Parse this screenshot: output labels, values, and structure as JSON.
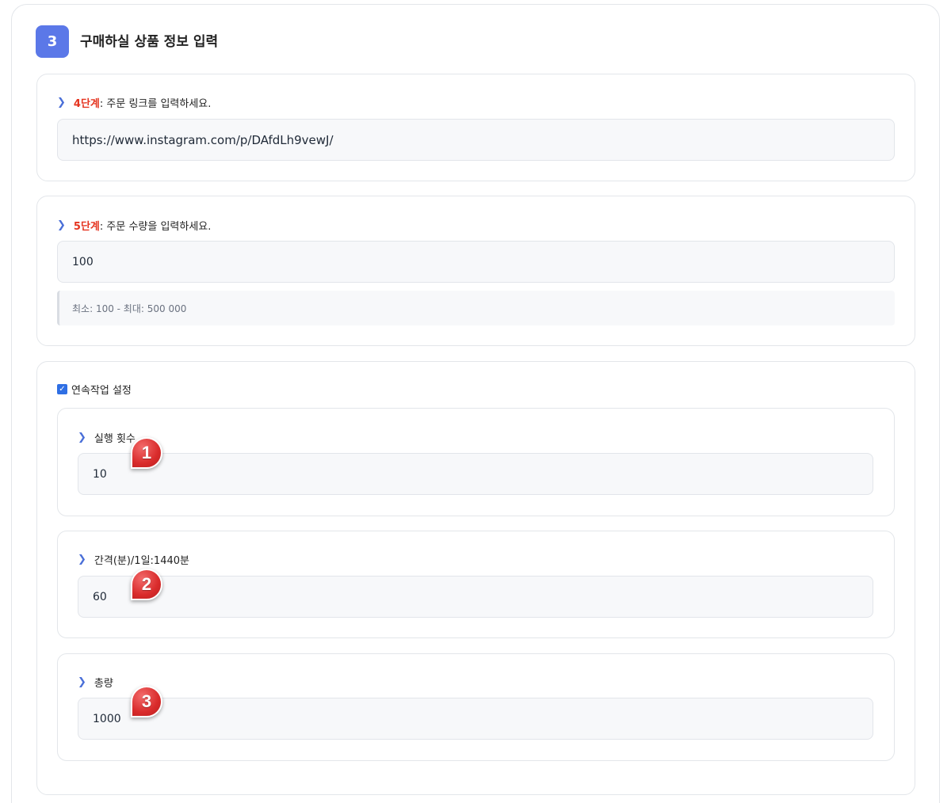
{
  "section": {
    "step_number": "3",
    "title": "구매하실 상품 정보 입력"
  },
  "link_step": {
    "step": "4단계",
    "label": ": 주문 링크를 입력하세요.",
    "value": "https://www.instagram.com/p/DAfdLh9vewJ/"
  },
  "quantity_step": {
    "step": "5단계",
    "label": ": 주문 수량을 입력하세요.",
    "value": "100",
    "hint": "최소: 100 - 최대: 500 000"
  },
  "repeat": {
    "checkbox_label": "연속작업 설정",
    "checked": true,
    "runs": {
      "label": "실행 횟수",
      "value": "10",
      "marker": "1"
    },
    "interval": {
      "label": "간격(분)/1일:1440분",
      "value": "60",
      "marker": "2"
    },
    "total": {
      "label": "총량",
      "value": "1000",
      "marker": "3"
    }
  },
  "icons": {
    "chevron": "chevron-right-icon",
    "check": "check-icon"
  },
  "colors": {
    "accent": "#5b78e8",
    "step_red": "#e5341f",
    "marker_red": "#d92b2b"
  }
}
